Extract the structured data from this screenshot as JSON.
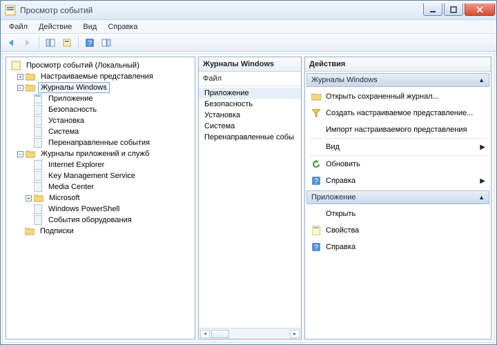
{
  "window": {
    "title": "Просмотр событий"
  },
  "menu": {
    "file": "Файл",
    "action": "Действие",
    "view": "Вид",
    "help": "Справка"
  },
  "tree": {
    "root": "Просмотр событий (Локальный)",
    "custom_views": "Настраиваемые представления",
    "windows_logs": "Журналы Windows",
    "app": "Приложение",
    "security": "Безопасность",
    "setup": "Установка",
    "system": "Система",
    "forwarded": "Перенаправленные события",
    "app_services": "Журналы приложений и служб",
    "ie": "Internet Explorer",
    "kms": "Key Management Service",
    "mc": "Media Center",
    "ms": "Microsoft",
    "ps": "Windows PowerShell",
    "hw": "События оборудования",
    "subs": "Подписки"
  },
  "mid": {
    "header": "Журналы Windows",
    "col": "Файл",
    "items": {
      "app": "Приложение",
      "security": "Безопасность",
      "setup": "Установка",
      "system": "Система",
      "forwarded": "Перенаправленные собы"
    }
  },
  "actions": {
    "header": "Действия",
    "section1": "Журналы Windows",
    "open_saved": "Открыть сохраненный журнал...",
    "create_custom": "Создать настраиваемое представление...",
    "import_custom": "Импорт настраиваемого представления",
    "view": "Вид",
    "refresh": "Обновить",
    "help": "Справка",
    "section2": "Приложение",
    "open": "Открыть",
    "props": "Свойства",
    "help2": "Справка"
  }
}
